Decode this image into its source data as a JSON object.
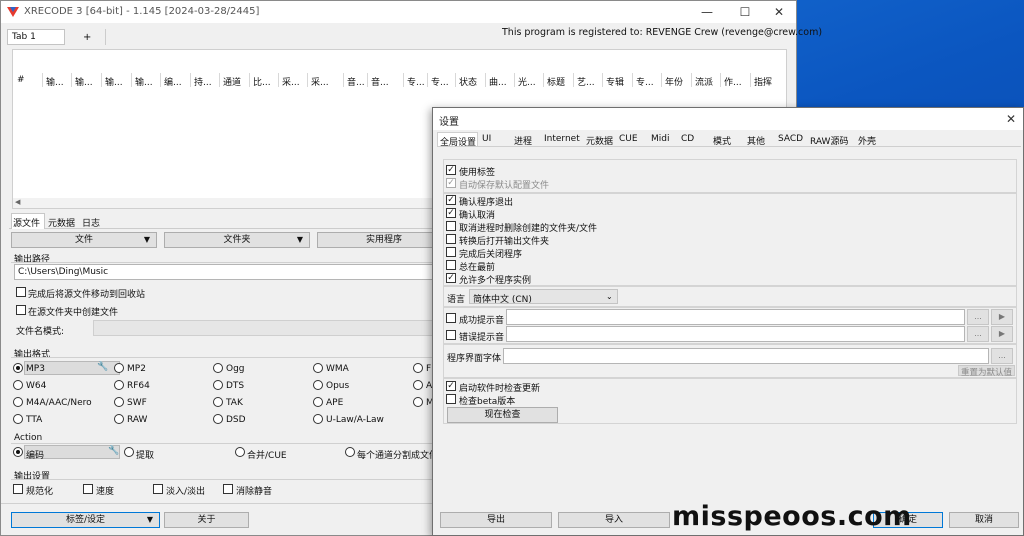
{
  "main_window": {
    "title": "XRECODE 3 [64-bit] - 1.145 [2024-03-28/2445]",
    "min_icon": "minimize-icon",
    "max_icon": "maximize-icon",
    "close_icon": "close-icon",
    "tabs": {
      "tab1": "Tab 1",
      "add": "+"
    },
    "registered": "This program is registered to: REVENGE Crew (revenge@crew.com)",
    "columns": [
      "#",
      "输...",
      "输...",
      "输...",
      "输...",
      "编...",
      "持...",
      "通道",
      "比...",
      "采...",
      "采...",
      "音...",
      "音...",
      "专...",
      "专...",
      "状态",
      "曲...",
      "光...",
      "标题",
      "艺...",
      "专辑",
      "专...",
      "年份",
      "流派",
      "作...",
      "指挥"
    ],
    "bottom_tabs": [
      "源文件",
      "元数据",
      "日志"
    ],
    "buttons_row": {
      "files": "文件",
      "folder": "文件夹",
      "utility": "实用程序"
    },
    "output_path": {
      "title": "输出路径",
      "value": "C:\\Users\\Ding\\Music",
      "move_recycle": "完成后将源文件移动到回收站",
      "create_in_source": "在源文件夹中创建文件",
      "filename_pattern": "文件名模式:"
    },
    "output_format": {
      "title": "输出格式",
      "row1": [
        "MP3",
        "MP2",
        "Ogg",
        "WMA",
        "FL"
      ],
      "row2": [
        "W64",
        "RF64",
        "DTS",
        "Opus",
        "AL"
      ],
      "row3": [
        "M4A/AAC/Nero",
        "SWF",
        "TAK",
        "APE",
        "M"
      ],
      "row4": [
        "TTA",
        "RAW",
        "DSD",
        "U-Law/A-Law"
      ]
    },
    "action": {
      "title": "Action",
      "encode": "编码",
      "extract": "提取",
      "merge": "合并/CUE",
      "split": "每个通道分割成文件"
    },
    "output_settings": {
      "title": "输出设置",
      "normalize": "规范化",
      "speed": "速度",
      "fade": "淡入/淡出",
      "silence": "消除静音"
    },
    "footer": {
      "tags_settings": "标签/设定",
      "about": "关于"
    }
  },
  "settings_dialog": {
    "title": "设置",
    "close_icon": "close-icon",
    "tabs": [
      "全局设置",
      "UI",
      "进程",
      "Internet",
      "元数据",
      "CUE",
      "Midi",
      "CD",
      "模式",
      "其他",
      "SACD",
      "RAW源码",
      "外壳"
    ],
    "checks1": [
      {
        "label": "使用标签",
        "checked": true,
        "disabled": false
      },
      {
        "label": "自动保存默认配置文件",
        "checked": true,
        "disabled": true
      }
    ],
    "checks2": [
      {
        "label": "确认程序退出",
        "checked": true
      },
      {
        "label": "确认取消",
        "checked": true
      },
      {
        "label": "取消进程时删除创建的文件夹/文件",
        "checked": false
      },
      {
        "label": "转换后打开输出文件夹",
        "checked": false
      },
      {
        "label": "完成后关闭程序",
        "checked": false
      },
      {
        "label": "总在最前",
        "checked": false
      },
      {
        "label": "允许多个程序实例",
        "checked": true
      }
    ],
    "language_label": "语言",
    "language_value": "简体中文 (CN)",
    "success_sound": "成功提示音",
    "error_sound": "错误提示音",
    "browse": "...",
    "play_icon": "play-icon",
    "ui_font_label": "程序界面字体",
    "reset_default": "重置为默认值",
    "check_updates": "启动软件时检查更新",
    "check_beta": "检查beta版本",
    "check_now": "现在检查",
    "footer": {
      "export": "导出",
      "import": "导入",
      "ok": "确定",
      "cancel": "取消"
    }
  },
  "watermark": "misspeoos.com"
}
